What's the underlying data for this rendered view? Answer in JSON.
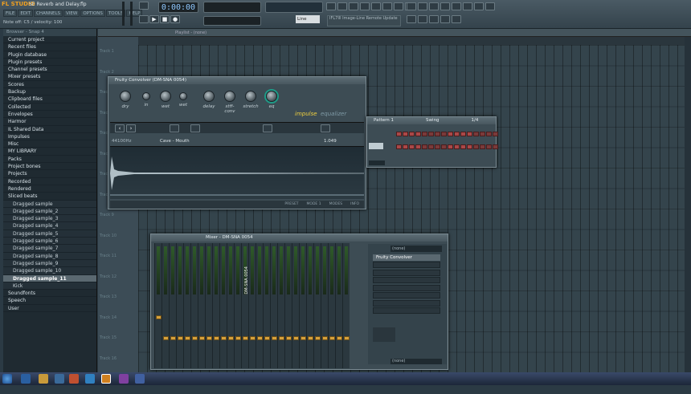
{
  "app": {
    "logo": "FL STUDIO",
    "file_title": "SE Reverb and Delay.flp"
  },
  "menu": [
    "FILE",
    "EDIT",
    "CHANNELS",
    "VIEW",
    "OPTIONS",
    "TOOLS",
    "HELP"
  ],
  "hint_bar": "Note off: C5 / velocity: 100",
  "transport": {
    "time": "0:00:00",
    "mode": "Line"
  },
  "hint_box": "IFL7Ill Image-Line Remote Update",
  "browser": {
    "header": "Browser - Snap 4",
    "items": [
      {
        "label": "Current project",
        "type": "folder"
      },
      {
        "label": "Recent files",
        "type": "folder"
      },
      {
        "label": "Plugin database",
        "type": "folder"
      },
      {
        "label": "Plugin presets",
        "type": "folder"
      },
      {
        "label": "Channel presets",
        "type": "folder"
      },
      {
        "label": "Mixer presets",
        "type": "folder"
      },
      {
        "label": "Scores",
        "type": "folder"
      },
      {
        "label": "Backup",
        "type": "folder"
      },
      {
        "label": "Clipboard files",
        "type": "folder"
      },
      {
        "label": "Collected",
        "type": "folder"
      },
      {
        "label": "Envelopes",
        "type": "folder"
      },
      {
        "label": "Harmor",
        "type": "folder"
      },
      {
        "label": "IL Shared Data",
        "type": "folder"
      },
      {
        "label": "Impulses",
        "type": "folder"
      },
      {
        "label": "Misc",
        "type": "folder"
      },
      {
        "label": "MY LIBRARY",
        "type": "folder"
      },
      {
        "label": "Packs",
        "type": "folder"
      },
      {
        "label": "Project bones",
        "type": "folder"
      },
      {
        "label": "Projects",
        "type": "folder"
      },
      {
        "label": "Recorded",
        "type": "folder"
      },
      {
        "label": "Rendered",
        "type": "folder"
      },
      {
        "label": "Sliced beats",
        "type": "folder"
      },
      {
        "label": "Dragged sample",
        "type": "sub"
      },
      {
        "label": "Dragged sample_2",
        "type": "sub"
      },
      {
        "label": "Dragged sample_3",
        "type": "sub"
      },
      {
        "label": "Dragged sample_4",
        "type": "sub"
      },
      {
        "label": "Dragged sample_5",
        "type": "sub"
      },
      {
        "label": "Dragged sample_6",
        "type": "sub"
      },
      {
        "label": "Dragged sample_7",
        "type": "sub"
      },
      {
        "label": "Dragged sample_8",
        "type": "sub"
      },
      {
        "label": "Dragged sample_9",
        "type": "sub"
      },
      {
        "label": "Dragged sample_10",
        "type": "sub"
      },
      {
        "label": "Dragged sample_11",
        "type": "selected"
      },
      {
        "label": "Kick",
        "type": "sub"
      },
      {
        "label": "Soundfonts",
        "type": "folder"
      },
      {
        "label": "Speech",
        "type": "folder"
      },
      {
        "label": "User",
        "type": "folder"
      }
    ]
  },
  "playlist": {
    "title": "Playlist - (none)",
    "tracks": [
      "Track 1",
      "Track 2",
      "Track 3",
      "Track 4",
      "Track 5",
      "Track 6",
      "Track 7",
      "Track 8",
      "Track 9",
      "Track 10",
      "Track 11",
      "Track 12",
      "Track 13",
      "Track 14",
      "Track 15",
      "Track 16",
      "Track 17"
    ]
  },
  "convolver": {
    "title": "Fruity Convolver (DM-SNA 0054)",
    "knobs": [
      "dry",
      "in",
      "wet",
      "wet",
      "delay",
      "stff-conv",
      "stretch",
      "eq"
    ],
    "tabs": [
      "impulse",
      "equalizer"
    ],
    "sample_rate": "44100Hz",
    "impulse_name": "Cave - Mouth",
    "length": "1.049",
    "footer": [
      "PRESET",
      "MODE 1",
      "MODES",
      "INFO"
    ]
  },
  "pattern": {
    "title": "Pattern 1",
    "swing": "Swing",
    "value": "1/4"
  },
  "mixer": {
    "title": "Mixer - DM-SNA 0054",
    "fx_slot": "Fruity Convolver",
    "in_label": "(none)",
    "out_label": "(none)",
    "insert_label": "DM-SNA 0054"
  },
  "colors": {
    "accent": "#f0a020",
    "teal": "#1e9c88",
    "step": "#aa4848"
  }
}
